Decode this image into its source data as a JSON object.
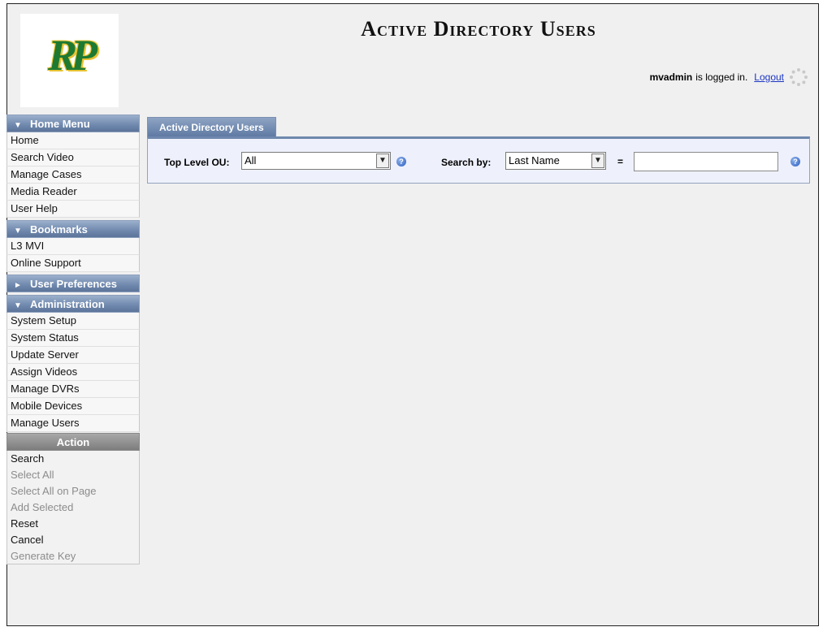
{
  "header": {
    "logo_text": "RP",
    "title": "Active Directory Users",
    "logged_user": "mvadmin",
    "logged_suffix": "is logged in.",
    "logout_label": "Logout"
  },
  "sidebar": {
    "home_menu": {
      "title": "Home Menu",
      "arrow": "▼",
      "items": [
        "Home",
        "Search Video",
        "Manage Cases",
        "Media Reader",
        "User Help"
      ]
    },
    "bookmarks": {
      "title": "Bookmarks",
      "arrow": "▼",
      "items": [
        "L3 MVI",
        "Online Support"
      ]
    },
    "user_preferences": {
      "title": "User Preferences",
      "arrow": "►"
    },
    "administration": {
      "title": "Administration",
      "arrow": "▼",
      "items": [
        "System Setup",
        "System Status",
        "Update Server",
        "Assign Videos",
        "Manage DVRs",
        "Mobile Devices",
        "Manage Users"
      ]
    },
    "action": {
      "title": "Action",
      "items": [
        {
          "label": "Search",
          "enabled": true
        },
        {
          "label": "Select All",
          "enabled": false
        },
        {
          "label": "Select All on Page",
          "enabled": false
        },
        {
          "label": "Add Selected",
          "enabled": false
        },
        {
          "label": "Reset",
          "enabled": true
        },
        {
          "label": "Cancel",
          "enabled": true
        },
        {
          "label": "Generate Key",
          "enabled": false
        }
      ]
    }
  },
  "main": {
    "tab_label": "Active Directory Users",
    "search": {
      "ou_label": "Top Level OU:",
      "ou_value": "All",
      "search_by_label": "Search by:",
      "search_by_value": "Last Name",
      "equals": "=",
      "search_text_value": ""
    }
  },
  "colors": {
    "menu_header": "#6f88ad",
    "action_header": "#7d7d7d",
    "panel_bg": "#eef1fb",
    "link": "#1a35c4",
    "logo_green": "#1e7a32",
    "logo_gold": "#e8c233"
  },
  "icons": {
    "help": "help-icon",
    "spinner": "spinner-icon",
    "dropdown": "chevron-down-icon"
  }
}
